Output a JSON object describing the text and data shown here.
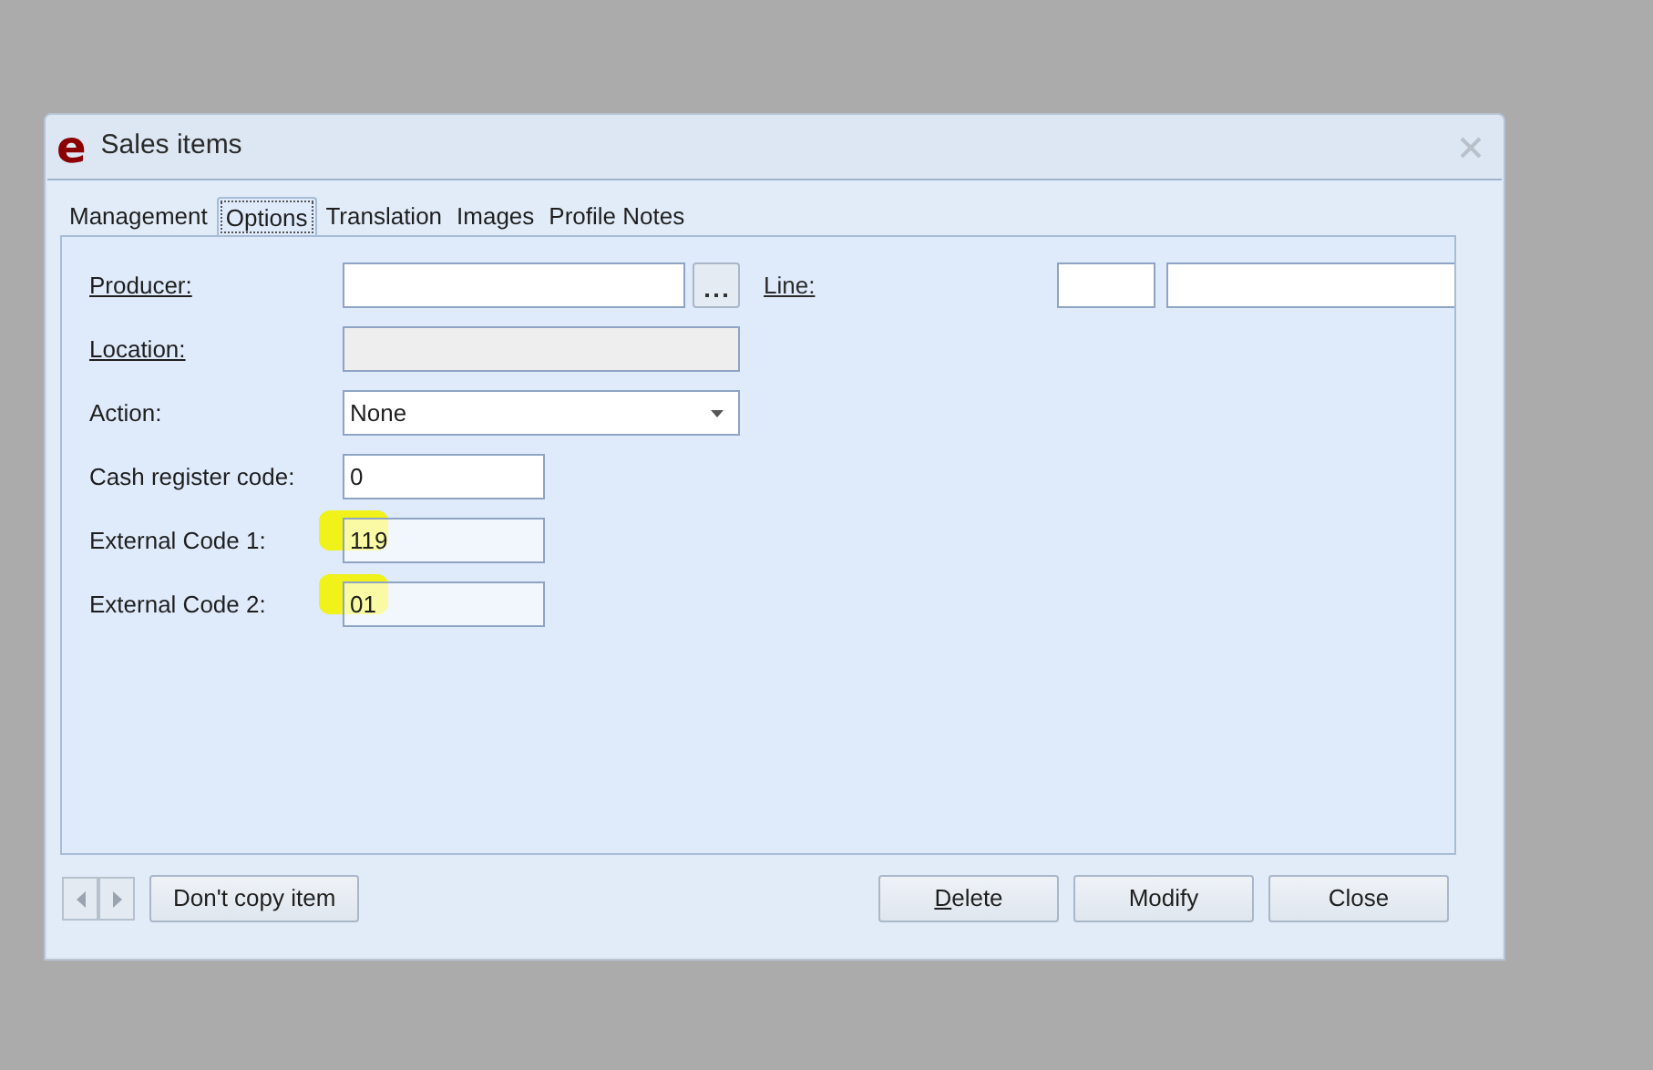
{
  "window": {
    "logo": "e",
    "title": "Sales items"
  },
  "tabs": [
    {
      "label": "Management",
      "selected": false
    },
    {
      "label": "Options",
      "selected": true
    },
    {
      "label": "Translation",
      "selected": false
    },
    {
      "label": "Images",
      "selected": false
    },
    {
      "label": "Profile Notes",
      "selected": false
    }
  ],
  "fields": [
    {
      "kind": "lookup",
      "label": "Producer:",
      "link": true,
      "disabled": false,
      "highlighted": false
    },
    {
      "kind": "text",
      "label": "Location:",
      "link": true,
      "disabled": true,
      "highlighted": false
    },
    {
      "kind": "dropdown",
      "label": "Action:",
      "link": false,
      "value": "None",
      "disabled": false,
      "highlighted": false
    },
    {
      "kind": "short",
      "label": "Cash register code:",
      "link": false,
      "value": "0",
      "disabled": false,
      "highlighted": false
    },
    {
      "kind": "short",
      "label": "External Code 1:",
      "link": false,
      "value": "119",
      "disabled": false,
      "highlighted": true
    },
    {
      "kind": "short",
      "label": "External Code 2:",
      "link": false,
      "value": "01",
      "disabled": false,
      "highlighted": true
    }
  ],
  "line": {
    "label": "Line:"
  },
  "left_buttons": [
    {
      "label": "Don't copy item",
      "underline_first": false
    }
  ],
  "buttons": [
    {
      "label": "Delete",
      "underline_first": true
    },
    {
      "label": "Modify",
      "underline_first": false
    },
    {
      "label": "Close",
      "underline_first": false
    }
  ]
}
